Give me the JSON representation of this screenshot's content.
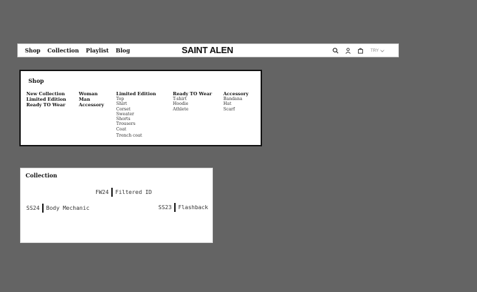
{
  "header": {
    "nav": [
      "Shop",
      "Collection",
      "Playlist",
      "Blog"
    ],
    "logo": "SAINT ALEN",
    "icons": [
      "search-icon",
      "user-icon",
      "cart-icon"
    ],
    "currency": "TRY",
    "currency_icon": "chevron-down-icon"
  },
  "shop": {
    "title": "Shop",
    "columns": [
      {
        "headers": [
          "New Collection",
          "Limited Edition",
          "Ready TO Wear"
        ],
        "items": []
      },
      {
        "headers": [
          "Woman",
          "Man",
          "Accessory"
        ],
        "items": []
      },
      {
        "headers": [
          "Limited Edition"
        ],
        "items": [
          "Top",
          "Shirt",
          "Corset",
          "Sweater",
          "Shorts",
          "Trousers",
          "Coat",
          "Trench coat"
        ]
      },
      {
        "headers": [
          "Ready TO Wear"
        ],
        "items": [
          "T-shirt",
          "Hoodie",
          "Athlete"
        ]
      },
      {
        "headers": [
          "Accessory"
        ],
        "items": [
          "Bandana",
          "Hat",
          "Scarf"
        ]
      }
    ]
  },
  "collection": {
    "title": "Collection",
    "items": [
      {
        "season": "FW24",
        "name": "Filtered ID"
      },
      {
        "season": "SS24",
        "name": "Body Mechanic"
      },
      {
        "season": "SS23",
        "name": "Flashback"
      }
    ]
  }
}
